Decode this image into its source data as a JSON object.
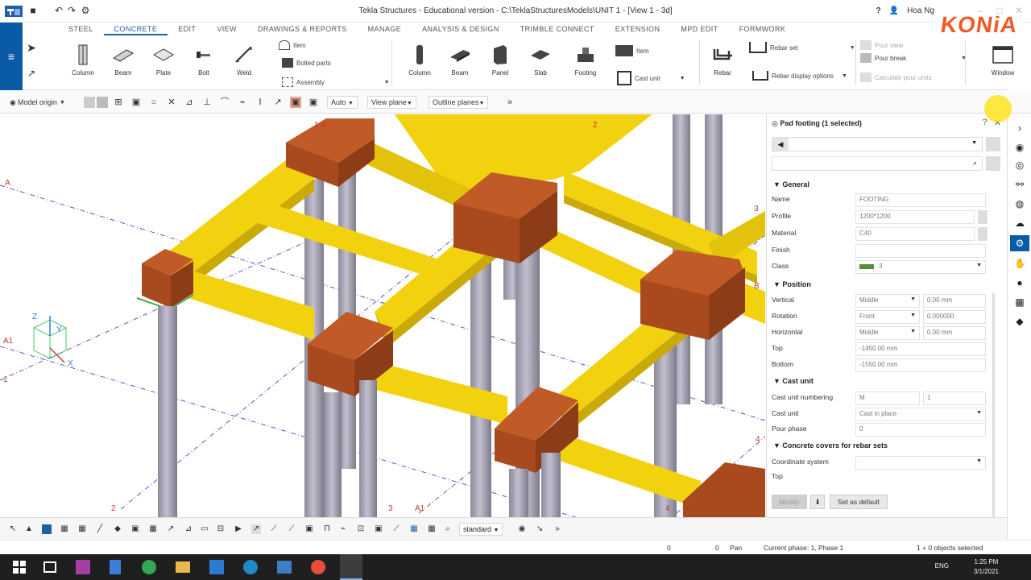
{
  "titlebar": {
    "title": "Tekla Structures - Educational version - C:\\TeklaStructuresModels\\UNIT 1 - [View 1 - 3d]",
    "user": "Hoa Ng",
    "help": "?"
  },
  "logo": {
    "text": "KONiA"
  },
  "ribbon": {
    "tabs": [
      "STEEL",
      "CONCRETE",
      "EDIT",
      "VIEW",
      "DRAWINGS & REPORTS",
      "MANAGE",
      "ANALYSIS & DESIGN",
      "TRIMBLE CONNECT",
      "EXTENSION",
      "MPD EDIT",
      "FORMWORK"
    ],
    "steel_tools": [
      "Column",
      "Beam",
      "Plate",
      "Bolt",
      "Weld"
    ],
    "steel_small": [
      "Item",
      "Bolted parts",
      "Assembly"
    ],
    "concrete_tools": [
      "Column",
      "Beam",
      "Panel",
      "Slab",
      "Footing"
    ],
    "concrete_small": [
      "Item",
      "Cast unit"
    ],
    "rebar_tool": "Rebar",
    "rebar_small": [
      "Rebar set",
      "Rebar display options"
    ],
    "pour_small": [
      "Pour view",
      "Pour break",
      "Calculate pour units"
    ],
    "window_tool": "Window"
  },
  "toolbar2": {
    "model_origin": "Model origin",
    "auto": "Auto",
    "view_plane": "View plane",
    "outline_planes": "Outline planes"
  },
  "viewport": {
    "grid_labels": [
      "A",
      "A1",
      "1",
      "2",
      "3",
      "A1",
      "1 B",
      "2",
      "3",
      "B",
      "4",
      "4"
    ],
    "axes": [
      "Z",
      "Y",
      "X"
    ]
  },
  "panel": {
    "header": "Pad footing (1 selected)",
    "sections": {
      "general": "General",
      "position": "Position",
      "cast_unit": "Cast unit",
      "covers": "Concrete covers for rebar sets"
    },
    "general": [
      {
        "label": "Name",
        "value": "FOOTING"
      },
      {
        "label": "Profile",
        "value": "1200*1200"
      },
      {
        "label": "Material",
        "value": "C40"
      },
      {
        "label": "Finish",
        "value": ""
      },
      {
        "label": "Class",
        "value": "3"
      }
    ],
    "position": [
      {
        "label": "Vertical",
        "select": "Middle",
        "value": "0.00 mm"
      },
      {
        "label": "Rotation",
        "select": "Front",
        "value": "0.000000"
      },
      {
        "label": "Horizontal",
        "select": "Middle",
        "value": "0.00 mm"
      },
      {
        "label": "Top",
        "value": "-1450.00 mm"
      },
      {
        "label": "Bottom",
        "value": "-1550.00 mm"
      }
    ],
    "cast_unit": [
      {
        "label": "Cast unit numbering",
        "prefix": "M",
        "start": "1"
      },
      {
        "label": "Cast unit",
        "value": "Cast in place"
      },
      {
        "label": "Pour phase",
        "value": "0"
      }
    ],
    "covers": [
      {
        "label": "Coordinate system",
        "value": ""
      },
      {
        "label": "Top",
        "value": ""
      }
    ],
    "modify_btn": "Modify",
    "default_btn": "Set as default"
  },
  "bottom_bar": {
    "mode": "standard"
  },
  "status": {
    "left_a": "0",
    "left_b": "0",
    "pan": "Pan",
    "phase": "Current phase: 1, Phase 1",
    "selected": "1 + 0 objects selected"
  },
  "taskbar": {
    "lang": "ENG",
    "time": "1:25 PM",
    "date": "3/1/2021"
  },
  "colors": {
    "accent": "#0b5aa5",
    "beam": "#f2d20f",
    "footing": "#a84a1d",
    "column": "#a3a0b0",
    "logo": "#f15a24"
  }
}
